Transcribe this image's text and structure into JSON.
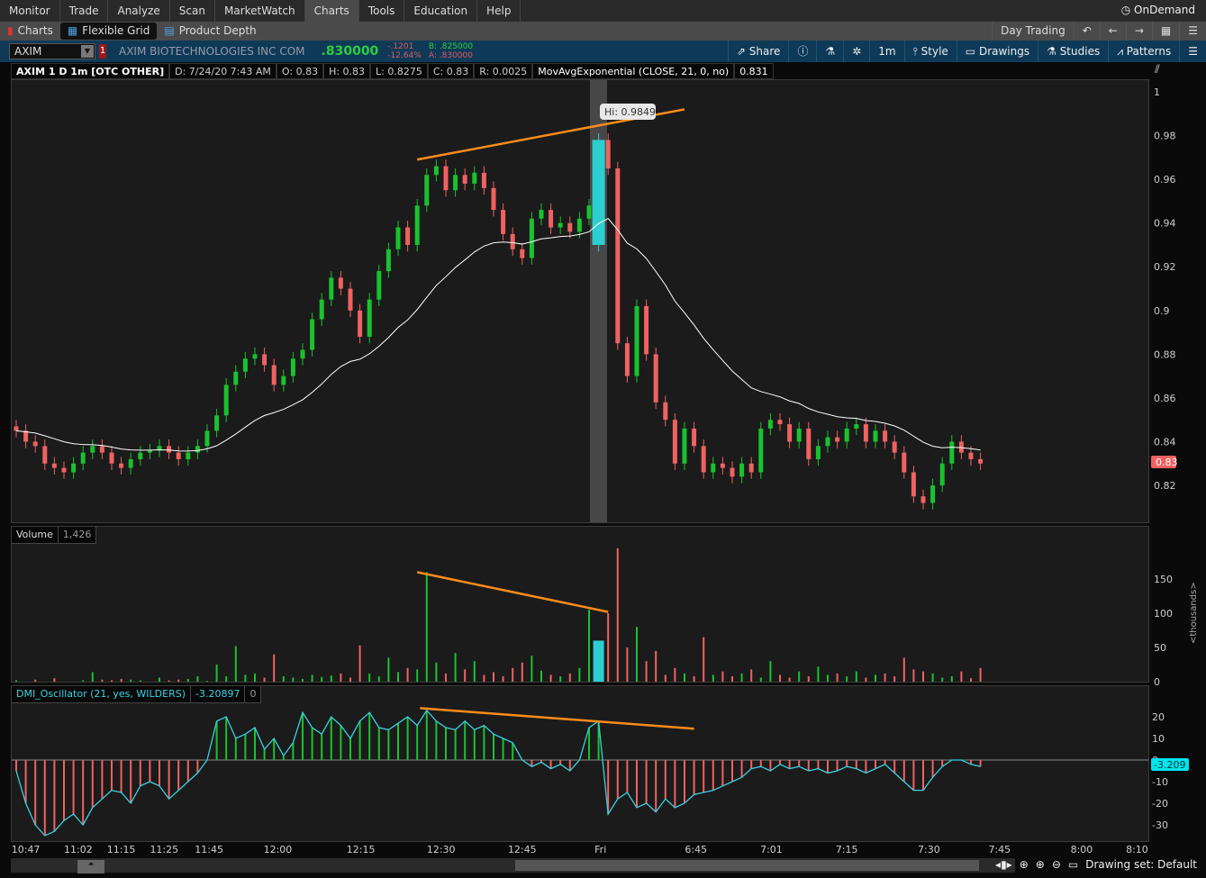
{
  "menu": {
    "tabs": [
      "Monitor",
      "Trade",
      "Analyze",
      "Scan",
      "MarketWatch",
      "Charts",
      "Tools",
      "Education",
      "Help"
    ],
    "active": "Charts",
    "ondemand": "OnDemand"
  },
  "subnav": {
    "tabs": [
      "Charts",
      "Flexible Grid",
      "Product Depth"
    ],
    "active": "Flexible Grid",
    "layout": "Day Trading"
  },
  "symbol": {
    "ticker": "AXIM",
    "link": "1",
    "company": "AXIM BIOTECHNOLOGIES INC COM",
    "last": ".830000",
    "change": "-.1201",
    "change_pct": "-12.64%",
    "bid": "B: .825000",
    "ask": "A: .830000"
  },
  "toolbar": {
    "share": "Share",
    "interval": "1m",
    "style": "Style",
    "drawings": "Drawings",
    "studies": "Studies",
    "patterns": "Patterns"
  },
  "legend": {
    "title": "AXIM 1 D 1m [OTC OTHER]",
    "date": "D: 7/24/20 7:43 AM",
    "open": "O: 0.83",
    "high": "H: 0.83",
    "low": "L: 0.8275",
    "close": "C: 0.83",
    "range": "R: 0.0025",
    "study": "MovAvgExponential (CLOSE, 21, 0, no)",
    "study_value": "0.831"
  },
  "volume_panel": {
    "label": "Volume",
    "value": "1,426",
    "unit": "<thousands>"
  },
  "dmi_panel": {
    "label": "DMI_Oscillator (21, yes, WILDERS)",
    "value": "-3.20897",
    "zero": "0"
  },
  "bottom": {
    "drawing_set": "Drawing set: Default"
  },
  "colors": {
    "up": "#19c22f",
    "down": "#f06262",
    "highlight": "#2ccfd0",
    "trend": "#ff8c1a",
    "ema": "#ffffff"
  },
  "chart_data": {
    "type": "candlestick",
    "ema_length": 21,
    "highlighted_bar": 61,
    "highlight_open": 0.93,
    "tooltip": "Hi: 0.9849",
    "current_price_label": "0.83",
    "current_dmi_label": "-3.209",
    "price_ticks": [
      "1",
      "0.98",
      "0.96",
      "0.94",
      "0.92",
      "0.9",
      "0.88",
      "0.86",
      "0.84",
      "0.82"
    ],
    "volume_ticks": [
      "150",
      "100",
      "50",
      "0"
    ],
    "dmi_ticks": [
      "20",
      "10",
      "0",
      "-10",
      "-20",
      "-30"
    ],
    "time_labels": [
      {
        "t": "10:47",
        "bar": 1
      },
      {
        "t": "11:02",
        "bar": 6.5
      },
      {
        "t": "11:15",
        "bar": 11
      },
      {
        "t": "11:25",
        "bar": 15.5
      },
      {
        "t": "11:45",
        "bar": 20.2
      },
      {
        "t": "12:00",
        "bar": 27.4
      },
      {
        "t": "12:15",
        "bar": 36.1
      },
      {
        "t": "12:30",
        "bar": 44.5
      },
      {
        "t": "12:45",
        "bar": 53
      },
      {
        "t": "Fri",
        "bar": 61.2
      },
      {
        "t": "6:45",
        "bar": 71.2
      },
      {
        "t": "7:01",
        "bar": 79.1
      },
      {
        "t": "7:15",
        "bar": 87
      },
      {
        "t": "7:30",
        "bar": 95.6
      },
      {
        "t": "7:45",
        "bar": 103
      },
      {
        "t": "8:00",
        "bar": 111.6
      },
      {
        "t": "8:10",
        "bar": 117.4
      }
    ],
    "close": [
      0.845,
      0.84,
      0.838,
      0.83,
      0.828,
      0.826,
      0.83,
      0.835,
      0.838,
      0.835,
      0.83,
      0.828,
      0.832,
      0.835,
      0.836,
      0.838,
      0.835,
      0.832,
      0.835,
      0.838,
      0.845,
      0.852,
      0.866,
      0.872,
      0.878,
      0.88,
      0.875,
      0.866,
      0.87,
      0.878,
      0.882,
      0.896,
      0.905,
      0.915,
      0.91,
      0.9,
      0.888,
      0.905,
      0.918,
      0.928,
      0.938,
      0.93,
      0.948,
      0.962,
      0.966,
      0.955,
      0.962,
      0.958,
      0.963,
      0.956,
      0.946,
      0.935,
      0.928,
      0.924,
      0.942,
      0.946,
      0.938,
      0.94,
      0.936,
      0.942,
      0.948,
      0.978,
      0.965,
      0.885,
      0.87,
      0.902,
      0.88,
      0.858,
      0.85,
      0.83,
      0.846,
      0.838,
      0.826,
      0.83,
      0.828,
      0.824,
      0.83,
      0.826,
      0.846,
      0.85,
      0.848,
      0.84,
      0.846,
      0.832,
      0.838,
      0.842,
      0.84,
      0.846,
      0.848,
      0.84,
      0.845,
      0.84,
      0.835,
      0.826,
      0.815,
      0.812,
      0.82,
      0.83,
      0.84,
      0.835,
      0.832,
      0.83
    ],
    "volume_k": [
      2,
      0,
      3,
      0,
      5,
      0,
      0,
      2,
      14,
      3,
      2,
      4,
      3,
      2,
      0,
      6,
      2,
      3,
      4,
      8,
      1,
      25,
      8,
      52,
      10,
      12,
      6,
      40,
      8,
      6,
      4,
      10,
      7,
      9,
      12,
      6,
      53,
      12,
      8,
      35,
      14,
      20,
      18,
      160,
      28,
      12,
      42,
      18,
      30,
      10,
      14,
      8,
      20,
      28,
      38,
      16,
      10,
      8,
      12,
      20,
      105,
      60,
      100,
      195,
      50,
      80,
      30,
      45,
      10,
      20,
      12,
      8,
      65,
      10,
      15,
      8,
      12,
      18,
      6,
      30,
      10,
      6,
      15,
      8,
      22,
      10,
      12,
      8,
      15,
      6,
      10,
      12,
      8,
      35,
      18,
      15,
      12,
      6,
      8,
      15,
      5,
      20
    ],
    "dmi": [
      -5,
      -20,
      -30,
      -35,
      -33,
      -28,
      -25,
      -30,
      -22,
      -18,
      -14,
      -15,
      -20,
      -12,
      -10,
      -12,
      -18,
      -14,
      -10,
      -6,
      0,
      18,
      20,
      10,
      12,
      15,
      5,
      10,
      2,
      8,
      22,
      15,
      12,
      20,
      16,
      10,
      18,
      22,
      15,
      14,
      17,
      20,
      16,
      23,
      18,
      15,
      14,
      18,
      14,
      16,
      12,
      10,
      8,
      0,
      -3,
      -1,
      -4,
      -2,
      -5,
      0,
      15,
      18,
      -25,
      -18,
      -15,
      -22,
      -20,
      -24,
      -18,
      -22,
      -20,
      -16,
      -15,
      -14,
      -12,
      -10,
      -8,
      -4,
      -3,
      -5,
      -2,
      -4,
      -3,
      -5,
      -4,
      -6,
      -5,
      -3,
      -4,
      -6,
      -4,
      -2,
      -6,
      -10,
      -14,
      -14,
      -8,
      -3,
      0,
      0,
      -2,
      -3
    ],
    "trendlines": [
      {
        "panel": "price",
        "from": {
          "bar": 42,
          "value": 0.969
        },
        "to": {
          "bar": 70,
          "value": 0.992
        }
      },
      {
        "panel": "volume",
        "from": {
          "bar": 42,
          "value": 160
        },
        "to": {
          "bar": 62,
          "value": 102
        }
      },
      {
        "panel": "dmi",
        "from": {
          "bar": 42.3,
          "value": 24
        },
        "to": {
          "bar": 71,
          "value": 14.5
        }
      }
    ]
  }
}
